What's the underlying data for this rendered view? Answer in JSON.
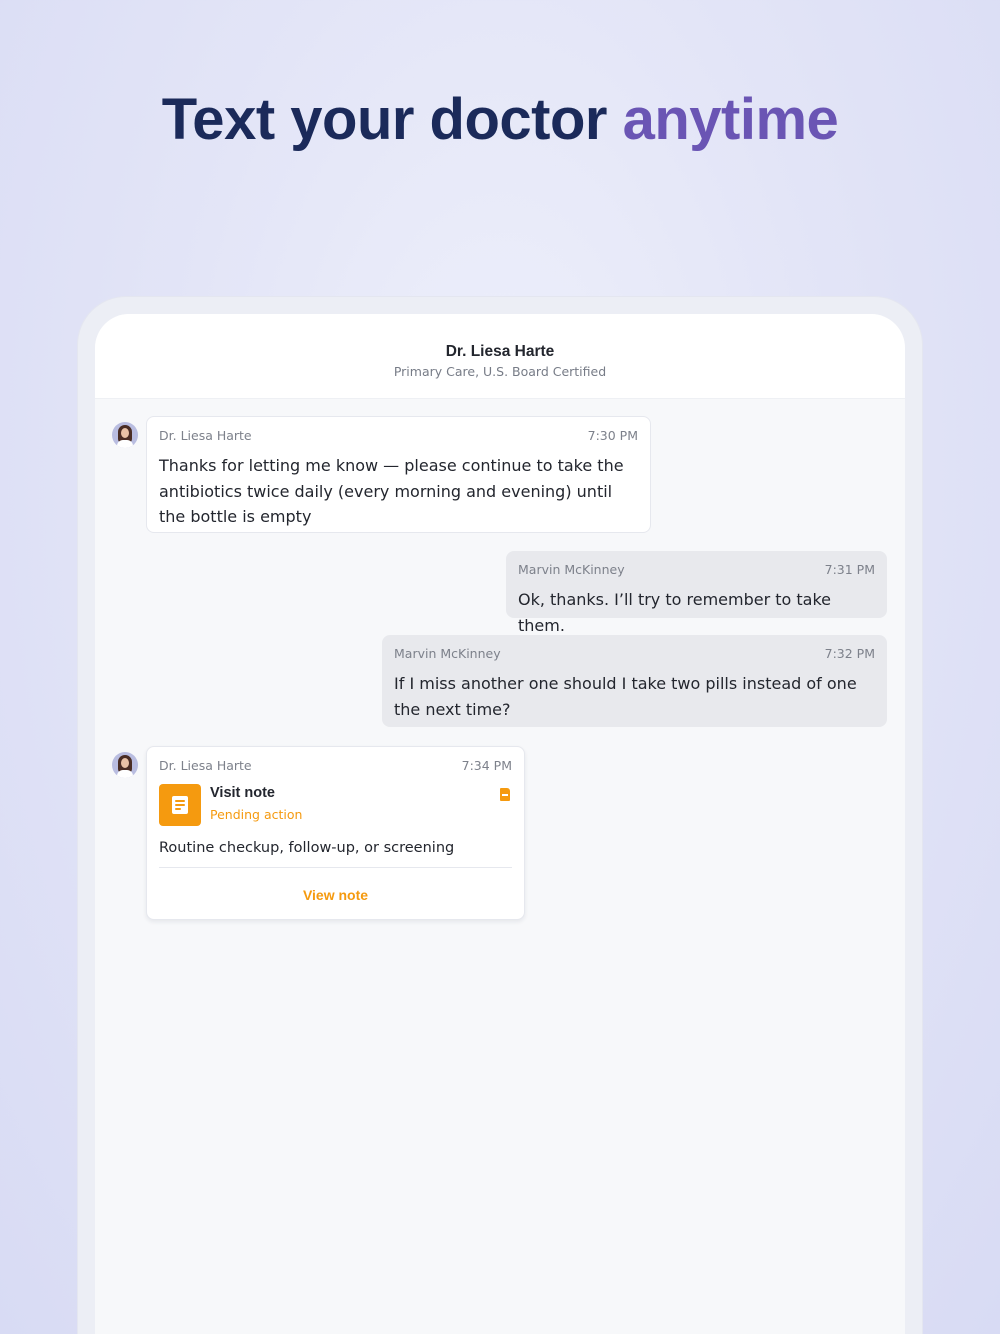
{
  "headline": {
    "main": "Text your doctor",
    "accent": "anytime"
  },
  "header": {
    "name": "Dr. Liesa Harte",
    "specialty": "Primary Care, U.S. Board Certified"
  },
  "messages": [
    {
      "sender": "Dr. Liesa Harte",
      "time": "7:30 PM",
      "text": "Thanks for letting me know — please continue to take the antibiotics twice daily (every morning and evening) until the bottle is empty"
    },
    {
      "sender": "Marvin McKinney",
      "time": "7:31 PM",
      "text": "Ok, thanks. I’ll try to remember to take them."
    },
    {
      "sender": "Marvin McKinney",
      "time": "7:32 PM",
      "text": "If I miss another one should I take two pills instead of one the next time?"
    }
  ],
  "note_message": {
    "sender": "Dr. Liesa Harte",
    "time": "7:34 PM",
    "title": "Visit note",
    "status": "Pending action",
    "description": "Routine checkup, follow-up, or screening",
    "action": "View note",
    "icon": "document-icon",
    "attachment_icon": "pdf-file-icon"
  },
  "colors": {
    "headline": "#1b2a5a",
    "accent": "#6a55b4",
    "orange": "#f59a0f",
    "outgoing_bubble": "#e8e9ed"
  }
}
